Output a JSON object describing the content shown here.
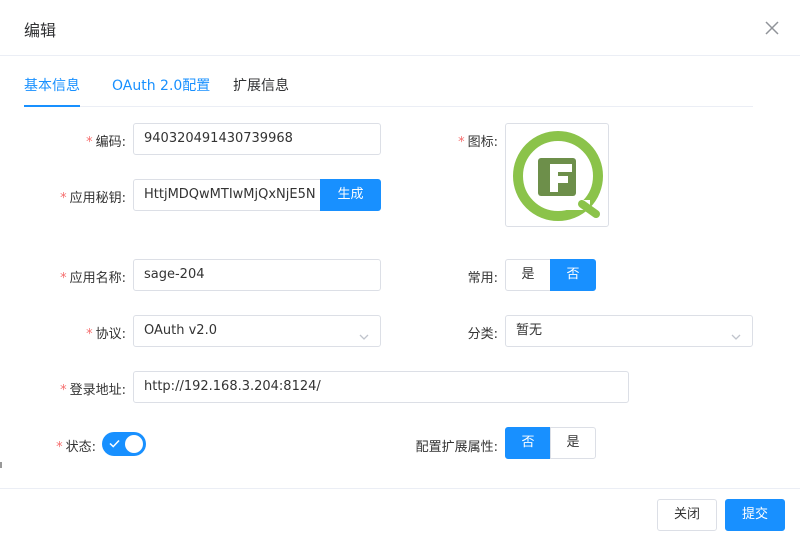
{
  "dialog": {
    "title": "编辑"
  },
  "tabs": [
    {
      "label": "基本信息",
      "active": true
    },
    {
      "label": "OAuth 2.0配置",
      "active": false
    },
    {
      "label": "扩展信息",
      "active": false
    }
  ],
  "form": {
    "code": {
      "label": "编码:",
      "value": "940320491430739968"
    },
    "secret": {
      "label": "应用秘钥:",
      "value": "HttjMDQwMTIwMjQxNjE5N",
      "generate_label": "生成"
    },
    "name": {
      "label": "应用名称:",
      "value": "sage-204"
    },
    "protocol": {
      "label": "协议:",
      "value": "OAuth v2.0"
    },
    "login_url": {
      "label": "登录地址:",
      "value": "http://192.168.3.204:8124/"
    },
    "status": {
      "label": "状态:",
      "enabled": true
    },
    "icon": {
      "label": "图标:"
    },
    "common": {
      "label": "常用:",
      "options": [
        "是",
        "否"
      ],
      "selected": "否"
    },
    "category": {
      "label": "分类:",
      "value": "暂无"
    },
    "ext_attr": {
      "label": "配置扩展属性:",
      "options": [
        "否",
        "是"
      ],
      "selected": "否"
    }
  },
  "footer": {
    "close_label": "关闭",
    "submit_label": "提交"
  },
  "colors": {
    "primary": "#1890ff",
    "required": "#f56c6c",
    "logo_green": "#8bc34a",
    "logo_dark": "#6d8f4a"
  }
}
